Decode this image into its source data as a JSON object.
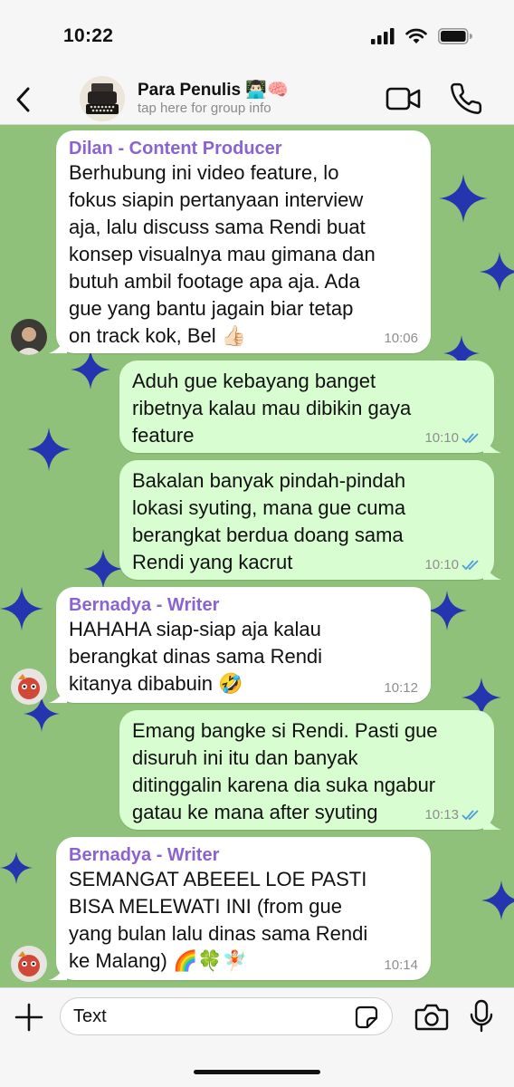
{
  "status_bar": {
    "time": "10:22"
  },
  "header": {
    "group_name": "Para Penulis 👨🏻‍💻🧠",
    "group_subtitle": "tap here for group info",
    "icons": [
      "back-chevron-icon",
      "video-call-icon",
      "phone-call-icon"
    ]
  },
  "messages": [
    {
      "direction": "incoming",
      "sender": "Dilan - Content Producer",
      "text": "Berhubung ini video feature, lo\nfokus siapin pertanyaan interview\naja, lalu discuss sama Rendi buat\nkonsep visualnya mau gimana dan\nbutuh ambil footage apa aja. Ada\ngue yang bantu jagain biar tetap\non track kok, Bel 👍🏻",
      "time": "10:06"
    },
    {
      "direction": "outgoing",
      "text": "Aduh gue kebayang banget\nribetnya kalau mau dibikin gaya\nfeature",
      "time": "10:10",
      "status": "read"
    },
    {
      "direction": "outgoing",
      "text": "Bakalan banyak pindah-pindah\nlokasi syuting, mana gue cuma\nberangkat berdua doang sama\nRendi yang kacrut",
      "time": "10:10",
      "status": "read"
    },
    {
      "direction": "incoming",
      "sender": "Bernadya - Writer",
      "text": "HAHAHA siap-siap aja kalau\nberangkat dinas sama Rendi\nkitanya dibabuin 🤣",
      "time": "10:12"
    },
    {
      "direction": "outgoing",
      "text": "Emang bangke si Rendi. Pasti gue\ndisuruh ini itu dan banyak\nditinggalin karena dia suka ngabur\ngatau ke mana after syuting",
      "time": "10:13",
      "status": "read"
    },
    {
      "direction": "incoming",
      "sender": "Bernadya - Writer",
      "text": "SEMANGAT ABEEEL LOE PASTI\nBISA MELEWATI INI (from gue\nyang bulan lalu dinas sama Rendi\nke Malang) 🌈🍀🧚🏻",
      "time": "10:14"
    }
  ],
  "input": {
    "placeholder": "Text"
  },
  "colors": {
    "chat_background": "#8fc17a",
    "star": "#2535b0",
    "outgoing_bubble": "#d8fdd0",
    "incoming_bubble": "#ffffff",
    "sender_name": "#8a63d2",
    "read_ticks": "#4f9be0"
  }
}
